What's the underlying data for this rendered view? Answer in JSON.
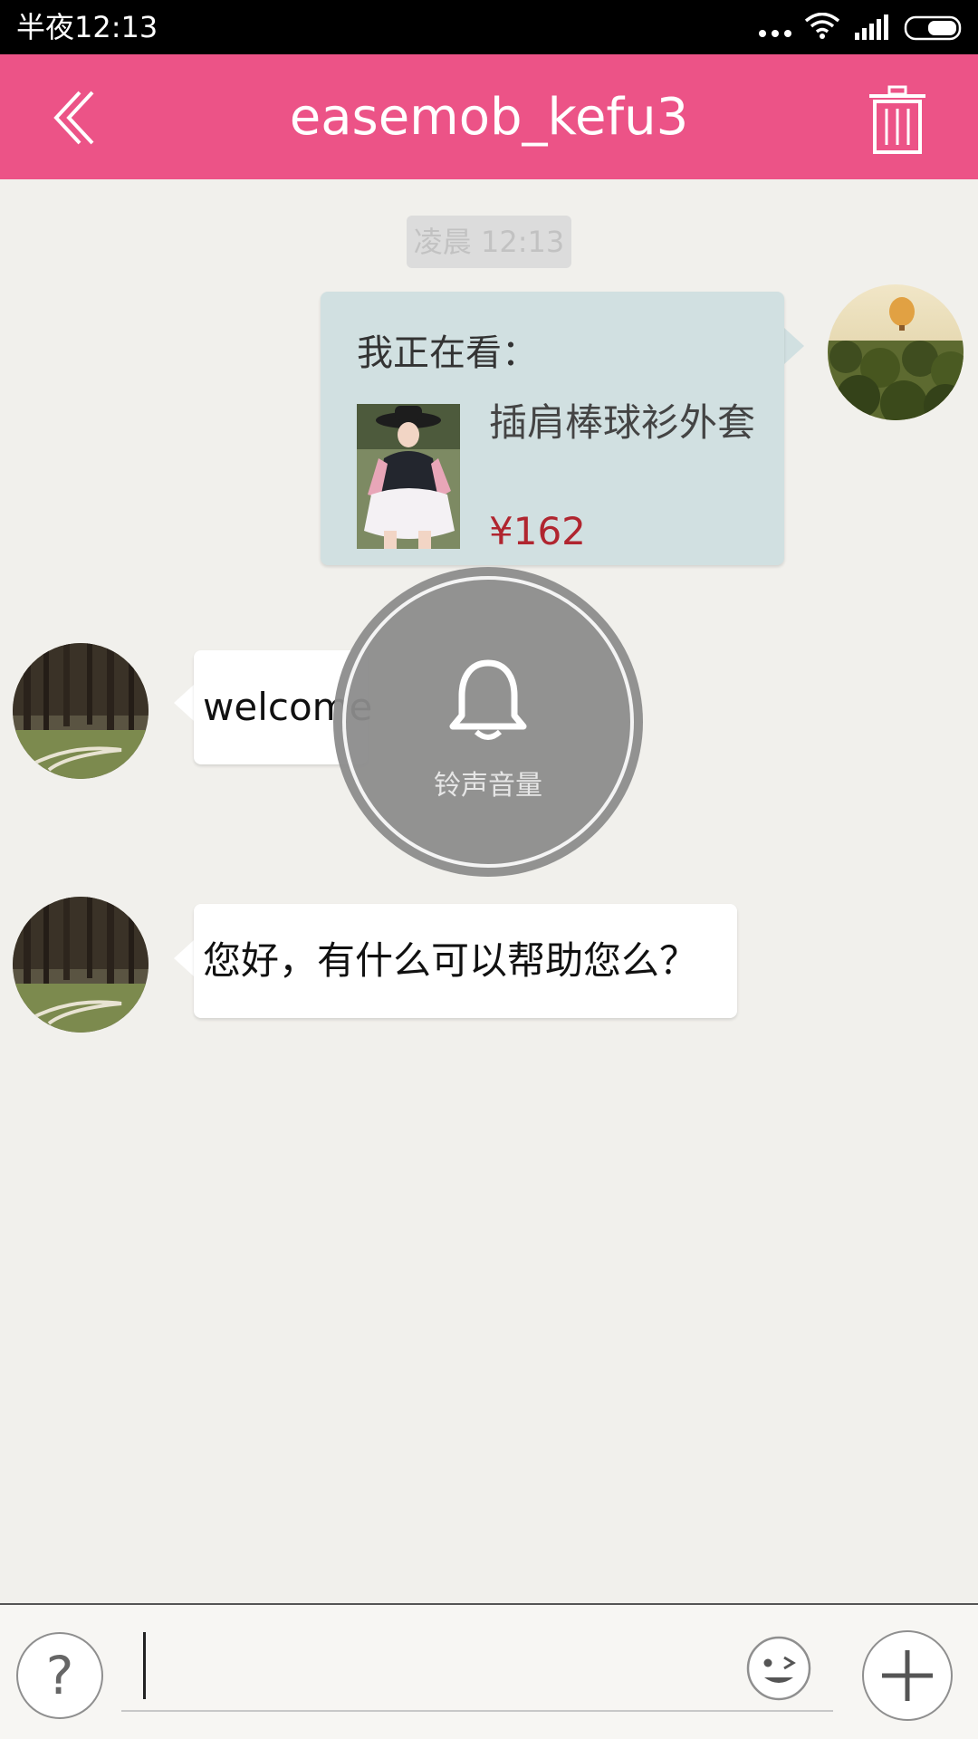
{
  "status_bar": {
    "time": "半夜12:13"
  },
  "header": {
    "title": "easemob_kefu3"
  },
  "chat": {
    "timestamp": "凌晨 12:13",
    "sent_card": {
      "label": "我正在看：",
      "product_name": "插肩棒球衫外套",
      "price": "¥162"
    },
    "messages": [
      {
        "text": "welcome"
      },
      {
        "text": "您好，有什么可以帮助您么？"
      }
    ]
  },
  "volume_overlay": {
    "label": "铃声音量"
  },
  "input_bar": {
    "help_symbol": "?",
    "message_value": ""
  },
  "colors": {
    "header": "#ec5387",
    "sent_bubble": "#d1e0e1",
    "price": "#b0252f",
    "background": "#f1f0ec"
  },
  "icons": [
    "back-icon",
    "trash-icon",
    "bell-icon",
    "emoji-icon",
    "plus-icon",
    "help-icon"
  ]
}
